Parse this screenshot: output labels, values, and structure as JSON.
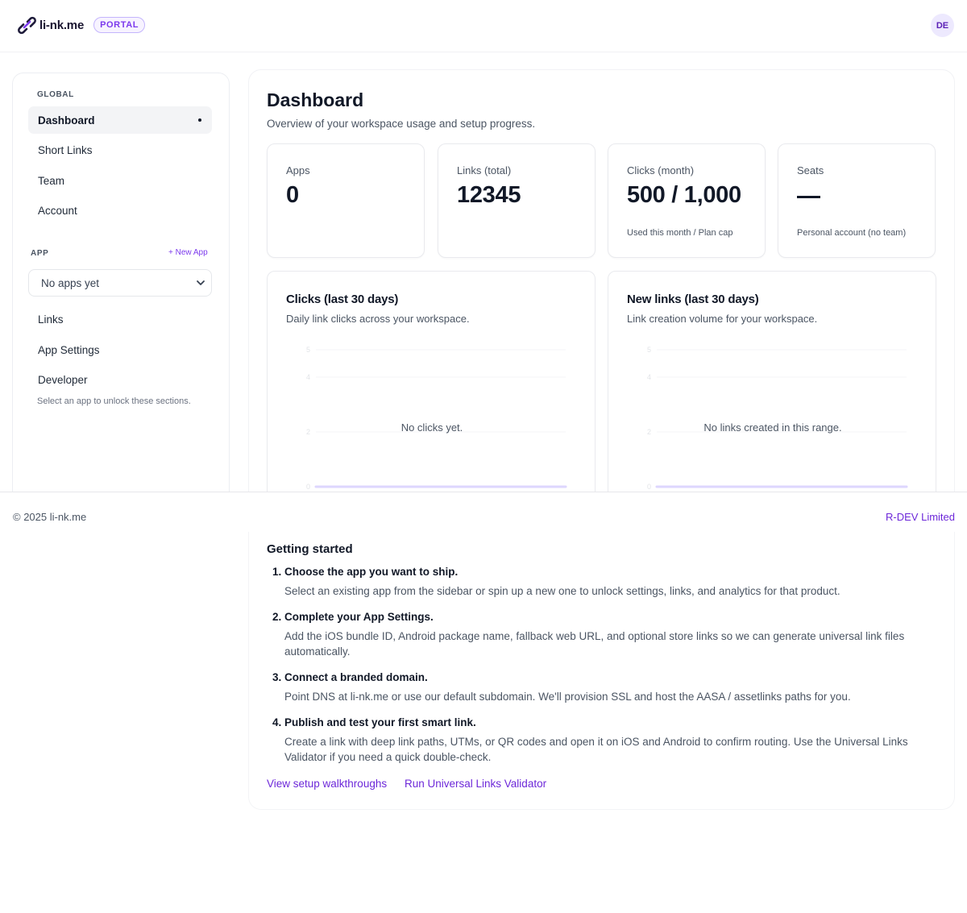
{
  "header": {
    "brand_name": "li-nk.me",
    "portal_badge": "PORTAL",
    "avatar_initials": "DE",
    "brand_color": "#6d28d9"
  },
  "sidebar": {
    "global_label": "GLOBAL",
    "global_items": [
      {
        "label": "Dashboard",
        "active": true
      },
      {
        "label": "Short Links"
      },
      {
        "label": "Team"
      },
      {
        "label": "Account"
      }
    ],
    "app_label": "APP",
    "new_app_label": "+ New App",
    "app_select_value": "No apps yet",
    "app_items": [
      {
        "label": "Links"
      },
      {
        "label": "App Settings"
      },
      {
        "label": "Developer"
      }
    ],
    "hint": "Select an app to unlock these sections."
  },
  "main": {
    "title": "Dashboard",
    "subtitle": "Overview of your workspace usage and setup progress.",
    "stats": [
      {
        "label": "Apps",
        "value": "0",
        "note": ""
      },
      {
        "label": "Links (total)",
        "value": "12345",
        "note": ""
      },
      {
        "label": "Clicks (month)",
        "value": "500 / 1,000",
        "note": "Used this month / Plan cap"
      },
      {
        "label": "Seats",
        "value": "—",
        "note": "Personal account (no team)"
      }
    ],
    "charts": [
      {
        "title": "Clicks (last 30 days)",
        "subtitle": "Daily link clicks across your workspace.",
        "empty": "No clicks yet."
      },
      {
        "title": "New links (last 30 days)",
        "subtitle": "Link creation volume for your workspace.",
        "empty": "No links created in this range."
      }
    ]
  },
  "chart_data": [
    {
      "type": "line",
      "title": "Clicks (last 30 days)",
      "y_ticks": [
        "5",
        "4",
        "2",
        "0"
      ],
      "series": [],
      "grid": true
    },
    {
      "type": "line",
      "title": "New links (last 30 days)",
      "y_ticks": [
        "5",
        "4",
        "2",
        "0"
      ],
      "series": [],
      "grid": true
    }
  ],
  "footer": {
    "copyright": "© 2025 li-nk.me",
    "company": "R-DEV Limited"
  },
  "getting_started": {
    "title": "Getting started",
    "steps": [
      {
        "head": "1. Choose the app you want to ship.",
        "body": "Select an existing app from the sidebar or spin up a new one to unlock settings, links, and analytics for that product."
      },
      {
        "head": "2. Complete your App Settings.",
        "body": "Add the iOS bundle ID, Android package name, fallback web URL, and optional store links so we can generate universal link files automatically."
      },
      {
        "head": "3. Connect a branded domain.",
        "body": "Point DNS at li-nk.me or use our default subdomain. We'll provision SSL and host the AASA / assetlinks paths for you."
      },
      {
        "head": "4. Publish and test your first smart link.",
        "body": "Create a link with deep link paths, UTMs, or QR codes and open it on iOS and Android to confirm routing. Use the Universal Links Validator if you need a quick double-check."
      }
    ],
    "links": [
      "View setup walkthroughs",
      "Run Universal Links Validator"
    ]
  }
}
